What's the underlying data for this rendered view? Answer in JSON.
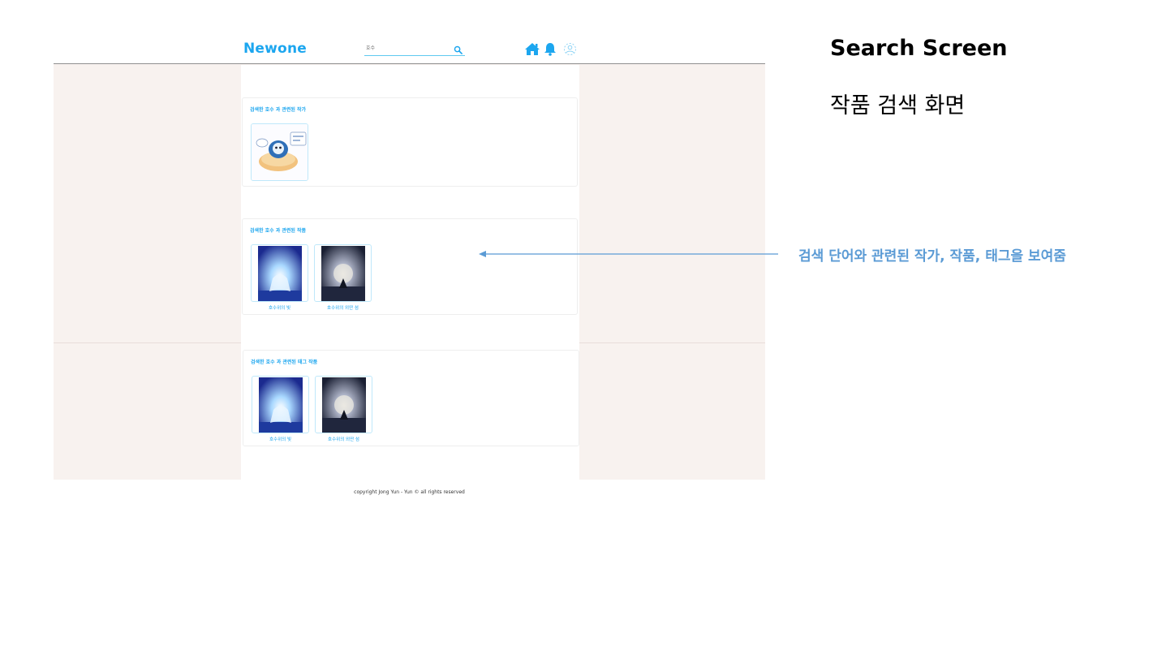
{
  "header": {
    "logo": "Newone",
    "search_value": "호수"
  },
  "sections": {
    "artists": {
      "title": "검색한 호수 과 관련된 작가"
    },
    "works": {
      "title": "검색한 호수 과 관련된 작품",
      "items": [
        {
          "caption": "호수위의 빛"
        },
        {
          "caption": "호수위의 외딴 섬"
        }
      ]
    },
    "tag_works": {
      "title": "검색한 호수 과 관련된 태그 작품",
      "items": [
        {
          "caption": "호수위의 빛"
        },
        {
          "caption": "호수위의 외딴 섬"
        }
      ]
    }
  },
  "footer": {
    "text": "copyright Jong Yun - Yun © all rights reserved"
  },
  "annotation": {
    "title": "Search Screen",
    "subtitle": "작품 검색 화면",
    "note": "검색 단어와 관련된 작가, 작품, 태그을 보여줌"
  },
  "colors": {
    "brand": "#1ca6ef",
    "page_bg": "#f8f2ef",
    "annotation_blue": "#5b9bd5"
  }
}
